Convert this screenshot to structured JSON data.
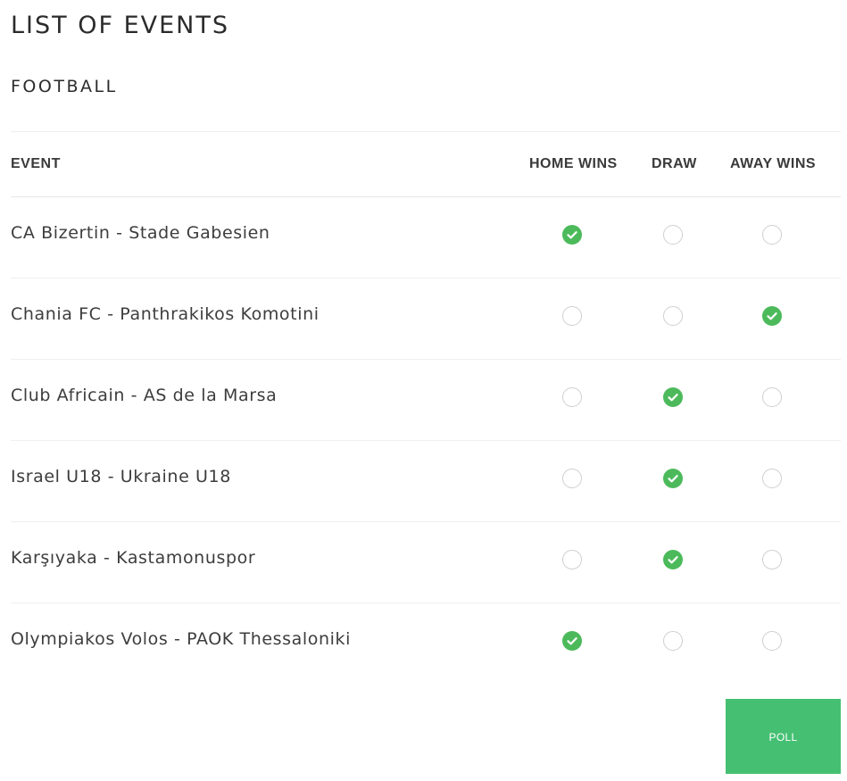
{
  "header": {
    "title": "LIST OF EVENTS",
    "sport": "FOOTBALL"
  },
  "table": {
    "columns": {
      "event": "EVENT",
      "home": "HOME WINS",
      "draw": "DRAW",
      "away": "AWAY WINS"
    },
    "rows": [
      {
        "event": "CA Bizertin - Stade Gabesien",
        "selected": "home"
      },
      {
        "event": "Chania FC - Panthrakikos Komotini",
        "selected": "away"
      },
      {
        "event": "Club Africain - AS de la Marsa",
        "selected": "draw"
      },
      {
        "event": "Israel U18 - Ukraine U18",
        "selected": "draw"
      },
      {
        "event": "Karşıyaka - Kastamonuspor",
        "selected": "draw"
      },
      {
        "event": "Olympiakos Volos - PAOK Thessaloniki",
        "selected": "home"
      }
    ]
  },
  "actions": {
    "poll_label": "POLL"
  },
  "colors": {
    "check_green": "#4cba5b",
    "button_green": "#45c073"
  },
  "icons": {
    "selected": "check-circle-icon",
    "unselected": "empty-radio-icon"
  }
}
